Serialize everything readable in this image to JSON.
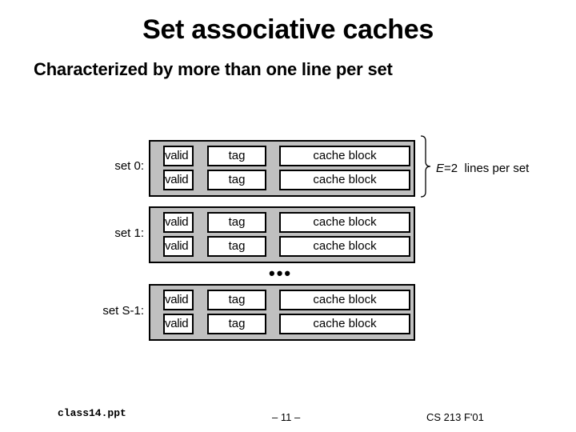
{
  "slide": {
    "title": "Set associative caches",
    "subtitle": "Characterized by more than one line per set"
  },
  "diagram": {
    "sets": [
      {
        "label": "set 0:",
        "lines": [
          {
            "valid": "valid",
            "tag": "tag",
            "block": "cache block"
          },
          {
            "valid": "valid",
            "tag": "tag",
            "block": "cache block"
          }
        ]
      },
      {
        "label": "set 1:",
        "lines": [
          {
            "valid": "valid",
            "tag": "tag",
            "block": "cache block"
          },
          {
            "valid": "valid",
            "tag": "tag",
            "block": "cache block"
          }
        ]
      },
      {
        "label": "set S-1:",
        "lines": [
          {
            "valid": "valid",
            "tag": "tag",
            "block": "cache block"
          },
          {
            "valid": "valid",
            "tag": "tag",
            "block": "cache block"
          }
        ]
      }
    ],
    "ellipsis": "•••",
    "brace_annotation": {
      "variable": "E",
      "value_text": "=2",
      "rest": "  lines per set"
    },
    "colors": {
      "set_fill": "#c0c0c0",
      "cell_fill": "#ffffff",
      "border": "#000000"
    }
  },
  "footer": {
    "filename": "class14.ppt",
    "page": "– 11 –",
    "course": "CS 213 F'01"
  }
}
